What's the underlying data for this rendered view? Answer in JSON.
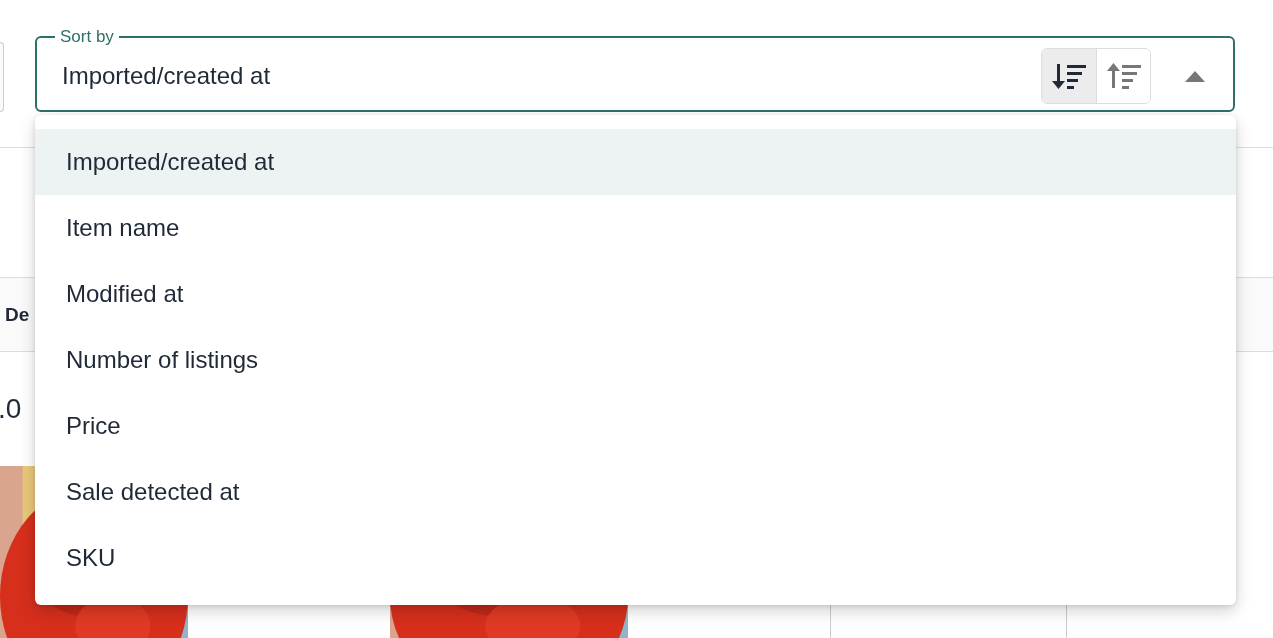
{
  "background": {
    "column_header": "De",
    "price_cell": ".0"
  },
  "sort_field": {
    "label": "Sort by",
    "value": "Imported/created at",
    "expanded": true,
    "order_buttons": [
      {
        "kind": "descending",
        "selected": true
      },
      {
        "kind": "ascending",
        "selected": false
      }
    ]
  },
  "options": [
    {
      "label": "Imported/created at",
      "selected": true
    },
    {
      "label": "Item name",
      "selected": false
    },
    {
      "label": "Modified at",
      "selected": false
    },
    {
      "label": "Number of listings",
      "selected": false
    },
    {
      "label": "Price",
      "selected": false
    },
    {
      "label": "Sale detected at",
      "selected": false
    },
    {
      "label": "SKU",
      "selected": false
    }
  ]
}
